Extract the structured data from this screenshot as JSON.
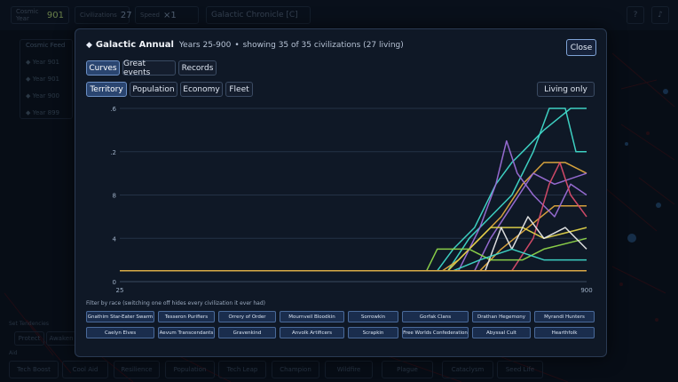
{
  "background": {
    "topbar": {
      "cosmic_year_label": "Cosmic Year",
      "cosmic_year_value": "901",
      "civilizations_label": "Civilizations",
      "civilizations_value": "27",
      "speed_label": "Speed",
      "speed_value": "×1",
      "chronicle_label": "Galactic Chronicle [C]",
      "help_label": "?",
      "music_icon": "music-note-icon"
    },
    "feed": {
      "title": "Cosmic Feed",
      "items": [
        "◆ Year 901",
        "◆ Year 901",
        "◆ Year 900",
        "◆ Year 899"
      ]
    },
    "tendencies": {
      "title": "Set Tendencies",
      "protect_label": "Protect",
      "awaken_label": "Awaken"
    },
    "aid_label": "Aid",
    "bottom_buttons": [
      "Tech Boost",
      "Cool Aid",
      "Resilience",
      "Population",
      "Tech Leap",
      "Champion",
      "Wildfire",
      "Plague",
      "Cataclysm",
      "Seed Life"
    ]
  },
  "dialog": {
    "title": "Galactic Annual",
    "years": "Years 25-900",
    "separator": "•",
    "showing": "showing 35 of 35 civilizations (27 living)",
    "close_label": "Close",
    "view_tabs": [
      {
        "label": "Curves",
        "active": true
      },
      {
        "label": "Great events",
        "active": false
      },
      {
        "label": "Records",
        "active": false
      }
    ],
    "metric_tabs": [
      {
        "label": "Territory",
        "active": true
      },
      {
        "label": "Population",
        "active": false
      },
      {
        "label": "Economy",
        "active": false
      },
      {
        "label": "Fleet",
        "active": false
      }
    ],
    "living_only_label": "Living only",
    "filter_label": "Filter by race (switching one off hides every civilization it ever had)",
    "races": [
      "Gnathim Star-Eater Swarm",
      "Tesseron Purifiers",
      "Orrery of Order",
      "Mournveil Bloodkin",
      "Sorrowkin",
      "Gorfak Clans",
      "Drathan Hegemony",
      "Myrandi Hunters",
      "Caelyn Elves",
      "Aevum Transcendants",
      "Gravenkind",
      "Anvolk Artificers",
      "Scrapkin",
      "Free Worlds Confederation",
      "Abyssal Cult",
      "Hearthfolk"
    ]
  },
  "chart_data": {
    "type": "line",
    "xlim": [
      25,
      900
    ],
    "ylim": [
      0,
      16
    ],
    "x_tick_labels": [
      "25",
      "900"
    ],
    "y_tick_labels": [
      "0",
      "4",
      "8",
      "12",
      "16"
    ],
    "grid": true,
    "series": [
      {
        "color": "#5b8fd6",
        "points": [
          [
            25,
            1
          ],
          [
            900,
            1
          ]
        ]
      },
      {
        "color": "#40d9c9",
        "points": [
          [
            25,
            1
          ],
          [
            620,
            1
          ],
          [
            650,
            3
          ],
          [
            690,
            5
          ],
          [
            730,
            9
          ],
          [
            760,
            11
          ],
          [
            780,
            12
          ],
          [
            820,
            14
          ],
          [
            870,
            16
          ],
          [
            900,
            16
          ]
        ]
      },
      {
        "color": "#40d9c9",
        "points": [
          [
            25,
            1
          ],
          [
            640,
            1
          ],
          [
            680,
            4
          ],
          [
            720,
            6
          ],
          [
            760,
            8
          ],
          [
            800,
            12
          ],
          [
            830,
            16
          ],
          [
            860,
            16
          ],
          [
            880,
            12
          ],
          [
            900,
            12
          ]
        ]
      },
      {
        "color": "#e0a93e",
        "points": [
          [
            25,
            1
          ],
          [
            630,
            1
          ],
          [
            660,
            2
          ],
          [
            700,
            4
          ],
          [
            740,
            6
          ],
          [
            780,
            9
          ],
          [
            820,
            11
          ],
          [
            860,
            11
          ],
          [
            900,
            10
          ]
        ]
      },
      {
        "color": "#e0a93e",
        "points": [
          [
            25,
            1
          ],
          [
            700,
            1
          ],
          [
            740,
            3
          ],
          [
            790,
            5
          ],
          [
            840,
            7
          ],
          [
            900,
            7
          ]
        ]
      },
      {
        "color": "#9c6fd8",
        "points": [
          [
            25,
            1
          ],
          [
            660,
            1
          ],
          [
            700,
            5
          ],
          [
            730,
            9
          ],
          [
            750,
            13
          ],
          [
            770,
            10
          ],
          [
            800,
            8
          ],
          [
            840,
            6
          ],
          [
            870,
            9
          ],
          [
            900,
            8
          ]
        ]
      },
      {
        "color": "#9c6fd8",
        "points": [
          [
            25,
            1
          ],
          [
            690,
            1
          ],
          [
            720,
            4
          ],
          [
            760,
            7
          ],
          [
            800,
            10
          ],
          [
            840,
            9
          ],
          [
            900,
            10
          ]
        ]
      },
      {
        "color": "#d94c6a",
        "points": [
          [
            25,
            1
          ],
          [
            760,
            1
          ],
          [
            800,
            4
          ],
          [
            830,
            9
          ],
          [
            850,
            11
          ],
          [
            870,
            8
          ],
          [
            900,
            6
          ]
        ]
      },
      {
        "color": "#e0d24a",
        "points": [
          [
            25,
            1
          ],
          [
            640,
            1
          ],
          [
            680,
            3
          ],
          [
            720,
            5
          ],
          [
            780,
            5
          ],
          [
            820,
            4
          ],
          [
            900,
            5
          ]
        ]
      },
      {
        "color": "#8fd64a",
        "points": [
          [
            25,
            1
          ],
          [
            600,
            1
          ],
          [
            620,
            3
          ],
          [
            680,
            3
          ],
          [
            720,
            2
          ],
          [
            780,
            2
          ],
          [
            820,
            3
          ],
          [
            900,
            4
          ]
        ]
      },
      {
        "color": "#e8e8e8",
        "points": [
          [
            25,
            1
          ],
          [
            710,
            1
          ],
          [
            740,
            5
          ],
          [
            760,
            3
          ],
          [
            790,
            6
          ],
          [
            820,
            4
          ],
          [
            860,
            5
          ],
          [
            900,
            3
          ]
        ]
      },
      {
        "color": "#40d9c9",
        "points": [
          [
            25,
            1
          ],
          [
            650,
            1
          ],
          [
            700,
            2
          ],
          [
            760,
            3
          ],
          [
            820,
            2
          ],
          [
            900,
            2
          ]
        ]
      },
      {
        "color": "#e0a93e",
        "points": [
          [
            25,
            1
          ],
          [
            900,
            1
          ]
        ]
      }
    ]
  }
}
